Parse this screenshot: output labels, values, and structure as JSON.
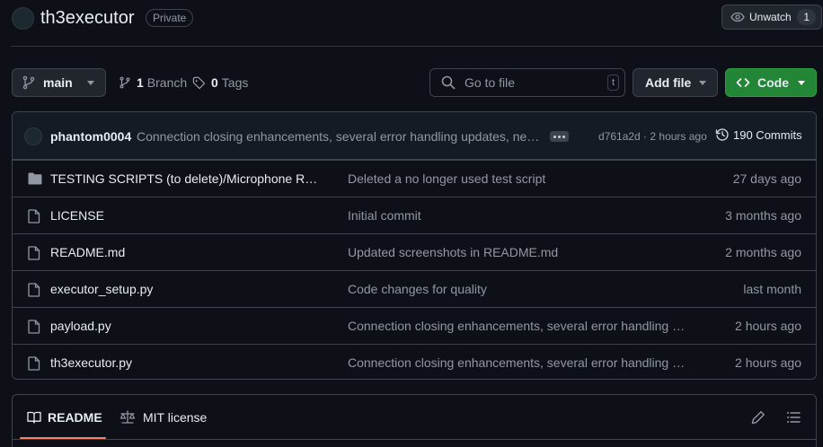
{
  "repo": {
    "name": "th3executor",
    "visibility": "Private",
    "watch_label": "Unwatch",
    "watch_count": "1"
  },
  "toolbar": {
    "branch": "main",
    "branches_count": "1",
    "branches_label": "Branch",
    "tags_count": "0",
    "tags_label": "Tags",
    "goto_placeholder": "Go to file",
    "goto_shortcut": "t",
    "add_file_label": "Add file",
    "code_label": "Code"
  },
  "latest_commit": {
    "author": "phantom0004",
    "message": "Connection closing enhancements, several error handling updates, need...",
    "sha_time": "d761a2d · 2 hours ago",
    "commits_label": "190 Commits"
  },
  "files": [
    {
      "type": "folder-icon",
      "name": "TESTING SCRIPTS (to delete)/Microphone Recor...",
      "message": "Deleted a no longer used test script",
      "age": "27 days ago"
    },
    {
      "type": "file-icon",
      "name": "LICENSE",
      "message": "Initial commit",
      "age": "3 months ago"
    },
    {
      "type": "file-icon",
      "name": "README.md",
      "message": "Updated screenshots in README.md",
      "age": "2 months ago"
    },
    {
      "type": "file-icon",
      "name": "executor_setup.py",
      "message": "Code changes for quality",
      "age": "last month"
    },
    {
      "type": "file-icon",
      "name": "payload.py",
      "message": "Connection closing enhancements, several error handling up...",
      "age": "2 hours ago"
    },
    {
      "type": "file-icon",
      "name": "th3executor.py",
      "message": "Connection closing enhancements, several error handling up...",
      "age": "2 hours ago"
    }
  ],
  "readme": {
    "tab_readme": "README",
    "tab_license": "MIT license"
  },
  "colors": {
    "accent_green": "#238636",
    "tab_underline": "#f78166",
    "background": "#0d1117"
  }
}
